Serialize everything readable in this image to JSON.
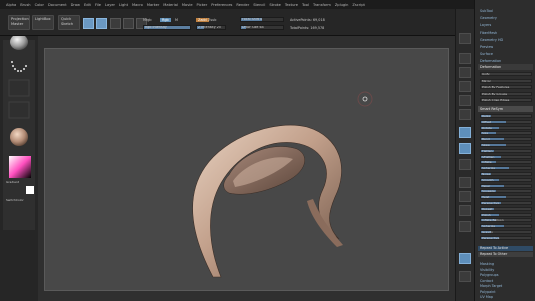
{
  "menubar": [
    "Alpha",
    "Brush",
    "Color",
    "Document",
    "Draw",
    "Edit",
    "File",
    "Layer",
    "Light",
    "Macro",
    "Marker",
    "Material",
    "Movie",
    "Picker",
    "Preferences",
    "Render",
    "Stencil",
    "Stroke",
    "Texture",
    "Tool",
    "Transform",
    "Zplugin",
    "Zscript"
  ],
  "toolbar": {
    "projection_label": "Projection Master",
    "lightbox_label": "LightBox",
    "quicksketch_label": "Quick Sketch",
    "mrgb_label": "Mrgb",
    "rgb_label": "Rgb",
    "m_label": "M",
    "zadd_label": "Zadd",
    "zsub_label": "Zsub",
    "rgb_intensity_label": "Rgb Intensity",
    "z_intensity_label": "Z Intensity 25",
    "focal_shift_label": "Focal Shift 0",
    "draw_size_label": "Draw Size 64",
    "active_points": "ActivePoints: 69,018",
    "total_points": "TotalPoints: 169,578"
  },
  "levels": {
    "rgb_intensity": 1.0,
    "z_intensity": 0.25,
    "focal_shift": 0.5,
    "draw_size": 0.12
  },
  "left": {
    "gradient_label": "Gradient",
    "switchcolor_label": "SwitchColor",
    "alternate_label": "Alternate"
  },
  "tray": {
    "top_items": [
      "SubTool",
      "Geometry",
      "Layers",
      "FiberMesh",
      "Geometry HD",
      "Preview",
      "Surface",
      "Deformation"
    ],
    "deformation_header": "Deformation",
    "sections": [
      "Unify",
      "Mirror",
      "Polish By Features",
      "Polish By Groups",
      "Polish Crisp Edges"
    ],
    "smart_resym": "Smart ReSym",
    "sliders": [
      "Relax",
      "Offset",
      "Rotate",
      "Size",
      "Bend",
      "Skew",
      "Flatten",
      "SFlatten",
      "Inflate",
      "Spherize",
      "Noise",
      "Smooth",
      "Taper",
      "Squeeze",
      "Twist",
      "Perspective",
      "Repeat",
      "Polish",
      "Inflate Balloon",
      "Spherize",
      "Gravity",
      "Perspective"
    ],
    "repeat_to_active": "Repeat To Active",
    "repeat_to_other": "Repeat To Other",
    "bottom_items": [
      "Masking",
      "Visibility",
      "Polygroups",
      "Contact",
      "Morph Target",
      "Polypaint",
      "UV Map",
      "Texture Map",
      "Displacement Map",
      "Normal Map"
    ]
  },
  "colors": {
    "accent": "#6a98c2",
    "model": "#c7a894"
  }
}
